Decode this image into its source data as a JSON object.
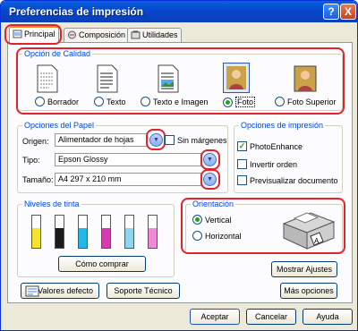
{
  "window": {
    "title": "Preferencias de impresión",
    "help_btn": "?",
    "close_btn": "X"
  },
  "tabs": [
    {
      "label": "Principal",
      "active": true
    },
    {
      "label": "Composición",
      "active": false
    },
    {
      "label": "Utilidades",
      "active": false
    }
  ],
  "quality": {
    "group_label": "Opción de Calidad",
    "options": [
      {
        "label": "Borrador",
        "selected": false
      },
      {
        "label": "Texto",
        "selected": false
      },
      {
        "label": "Texto e Imagen",
        "selected": false
      },
      {
        "label": "Foto",
        "selected": true
      },
      {
        "label": "Foto Superior",
        "selected": false
      }
    ]
  },
  "paper": {
    "group_label": "Opciones del Papel",
    "origin_label": "Origen:",
    "origin_value": "Alimentador de hojas",
    "borderless_label": "Sin márgenes",
    "type_label": "Tipo:",
    "type_value": "Epson Glossy",
    "size_label": "Tamaño:",
    "size_value": "A4 297 x 210 mm"
  },
  "print_options": {
    "group_label": "Opciones de impresión",
    "photoenhance": "PhotoEnhance",
    "photoenhance_checked": true,
    "reverse": "Invertir orden",
    "preview": "Previsualizar documento"
  },
  "ink": {
    "group_label": "Niveles de tinta",
    "buy_button": "Cómo comprar",
    "colors": [
      "#f5e32a",
      "#1a1a1a",
      "#21b7e6",
      "#d63ab3",
      "#8ad7ef",
      "#f08ad8"
    ],
    "levels": [
      0.6,
      0.6,
      0.6,
      0.6,
      0.6,
      0.6
    ]
  },
  "orientation": {
    "group_label": "Orientación",
    "vertical": "Vertical",
    "horizontal": "Horizontal",
    "selected": "Vertical"
  },
  "buttons": {
    "show_settings": "Mostrar Ajustes",
    "defaults": "Valores defecto",
    "support": "Soporte Técnico",
    "more_options": "Más opciones",
    "accept": "Aceptar",
    "cancel": "Cancelar",
    "help": "Ayuda"
  }
}
